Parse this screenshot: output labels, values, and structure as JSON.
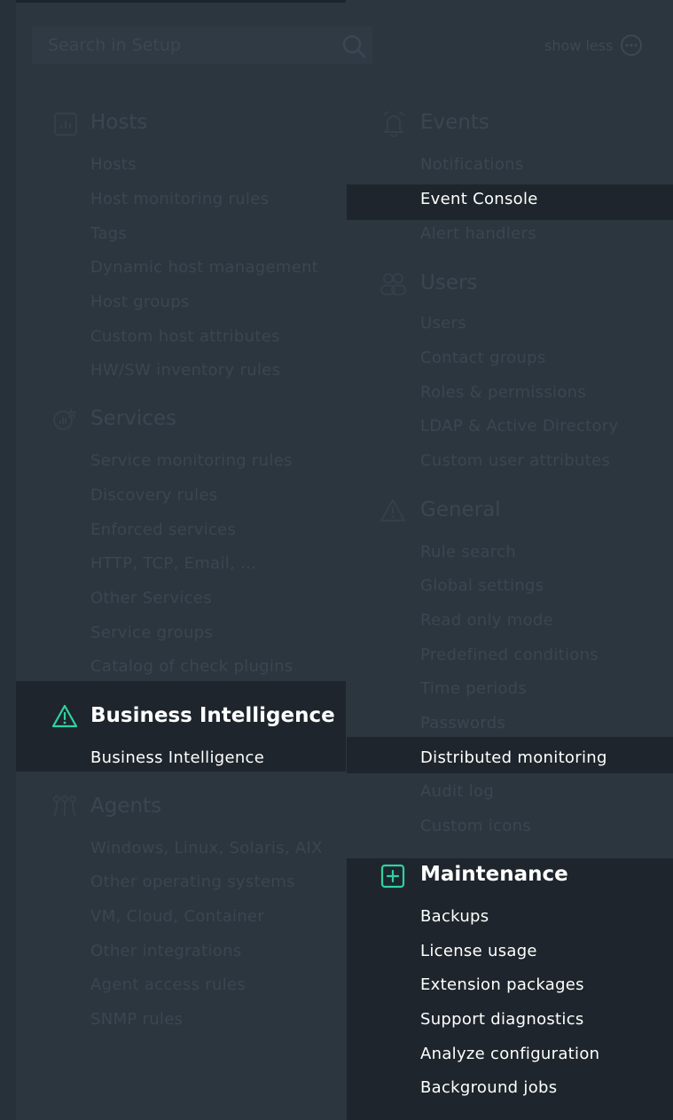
{
  "search": {
    "placeholder": "Search in Setup"
  },
  "header": {
    "toggle_label": "show less"
  },
  "hosts": {
    "title": "Hosts",
    "items": [
      "Hosts",
      "Host monitoring rules",
      "Tags",
      "Dynamic host management",
      "Host groups",
      "Custom host attributes",
      "HW/SW inventory rules"
    ]
  },
  "services": {
    "title": "Services",
    "items": [
      "Service monitoring rules",
      "Discovery rules",
      "Enforced services",
      "HTTP, TCP, Email, ...",
      "Other Services",
      "Service groups",
      "Catalog of check plugins"
    ]
  },
  "bi": {
    "title": "Business Intelligence",
    "items": [
      "Business Intelligence"
    ]
  },
  "agents": {
    "title": "Agents",
    "items": [
      "Windows, Linux, Solaris, AIX",
      "Other operating systems",
      "VM, Cloud, Container",
      "Other integrations",
      "Agent access rules",
      "SNMP rules"
    ]
  },
  "events": {
    "title": "Events",
    "items": [
      "Notifications",
      "Event Console",
      "Alert handlers"
    ]
  },
  "users": {
    "title": "Users",
    "items": [
      "Users",
      "Contact groups",
      "Roles & permissions",
      "LDAP & Active Directory",
      "Custom user attributes"
    ]
  },
  "general": {
    "title": "General",
    "items": [
      "Rule search",
      "Global settings",
      "Read only mode",
      "Predefined conditions",
      "Time periods",
      "Passwords",
      "Distributed monitoring",
      "Audit log",
      "Custom icons"
    ]
  },
  "maintenance": {
    "title": "Maintenance",
    "items": [
      "Backups",
      "License usage",
      "Extension packages",
      "Support diagnostics",
      "Analyze configuration",
      "Background jobs"
    ]
  },
  "colors": {
    "accent": "#2fd3a0",
    "panel": "#2c363f",
    "highlight": "#1e252c",
    "dim_text": "#3a4651"
  }
}
